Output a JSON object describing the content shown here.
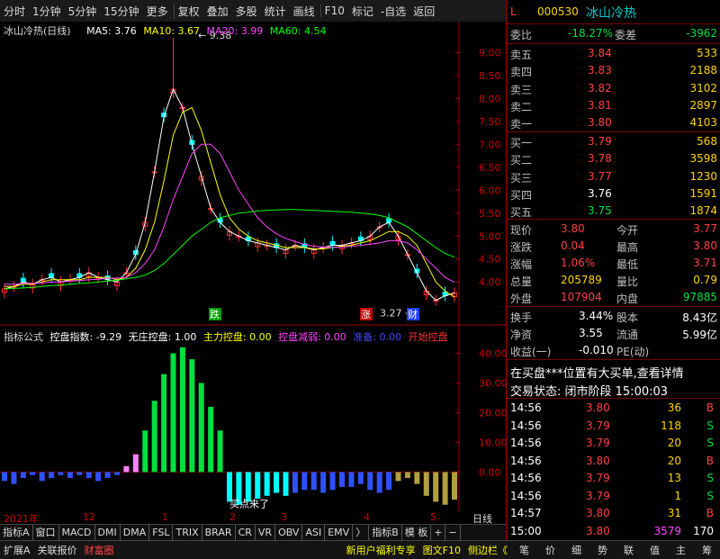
{
  "toolbar": [
    "分时",
    "1分钟",
    "5分钟",
    "15分钟",
    "更多",
    "复权",
    "叠加",
    "多股",
    "统计",
    "画线",
    "F10",
    "标记",
    "-自选",
    "返回"
  ],
  "main_info": {
    "title": "冰山冷热(日线)",
    "ma5_label": "MA5: 3.76",
    "ma10_label": "MA10: 3.67",
    "ma20_label": "MA20: 3.99",
    "ma60_label": "MA60: 4.54",
    "high_marker": "9.38",
    "low_marker": "3.27",
    "tag_down": "跌",
    "tag_up": "涨",
    "tag_cai": "财"
  },
  "indicator_info": {
    "name": "指标公式",
    "kp_label": "控盘指数: -9.29",
    "wz_label": "无庄控盘: 1.00",
    "zl_label": "主力控盘: 0.00",
    "kpjr_label": "控盘减弱: 0.00",
    "lj_label": "准备: 0.00",
    "ks_label": "开始控盘",
    "note_buy": "买点来了"
  },
  "colors": {
    "up": "#ff3030",
    "down": "#00ffff",
    "ma5": "#ffffff",
    "ma10": "#ffff00",
    "ma20": "#ff44ff",
    "ma60": "#00ff00",
    "axis": "#a00000"
  },
  "chart_data": [
    {
      "type": "line",
      "name": "k-line",
      "title": "冰山冷热(日线)",
      "y_ticks": [
        "9.00",
        "8.50",
        "8.00",
        "7.50",
        "7.00",
        "6.50",
        "6.00",
        "5.50",
        "5.00",
        "4.50",
        "4.00"
      ],
      "ylim": [
        3.2,
        9.4
      ],
      "series": [
        {
          "name": "MA5",
          "values": [
            3.85,
            3.9,
            4.0,
            3.95,
            4.05,
            4.1,
            4.0,
            4.05,
            4.1,
            4.2,
            4.1,
            4.05,
            4.0,
            4.2,
            4.6,
            5.3,
            6.4,
            7.6,
            8.2,
            7.8,
            7.0,
            6.3,
            5.6,
            5.3,
            5.1,
            5.0,
            4.9,
            4.85,
            4.8,
            4.75,
            4.7,
            4.8,
            4.75,
            4.7,
            4.75,
            4.8,
            4.8,
            4.85,
            4.9,
            5.0,
            5.2,
            5.3,
            5.0,
            4.6,
            4.2,
            3.8,
            3.6,
            3.7,
            3.76
          ]
        },
        {
          "name": "MA10",
          "values": [
            3.9,
            3.9,
            3.95,
            3.95,
            4.0,
            4.05,
            4.05,
            4.05,
            4.05,
            4.1,
            4.1,
            4.1,
            4.05,
            4.1,
            4.3,
            4.7,
            5.3,
            6.2,
            7.2,
            7.7,
            7.8,
            7.3,
            6.6,
            5.9,
            5.4,
            5.15,
            5.0,
            4.9,
            4.85,
            4.8,
            4.75,
            4.75,
            4.75,
            4.72,
            4.72,
            4.75,
            4.78,
            4.8,
            4.85,
            4.9,
            5.0,
            5.1,
            5.1,
            5.0,
            4.8,
            4.4,
            4.0,
            3.8,
            3.67
          ]
        },
        {
          "name": "MA20",
          "values": [
            3.95,
            3.95,
            3.97,
            3.97,
            3.98,
            4.0,
            4.0,
            4.02,
            4.03,
            4.05,
            4.06,
            4.08,
            4.08,
            4.1,
            4.2,
            4.4,
            4.7,
            5.2,
            5.8,
            6.3,
            6.8,
            7.0,
            7.0,
            6.8,
            6.4,
            6.0,
            5.7,
            5.4,
            5.2,
            5.05,
            4.95,
            4.88,
            4.82,
            4.78,
            4.76,
            4.75,
            4.76,
            4.78,
            4.8,
            4.82,
            4.85,
            4.9,
            4.9,
            4.85,
            4.7,
            4.5,
            4.3,
            4.1,
            3.99
          ]
        },
        {
          "name": "MA60",
          "values": [
            3.85,
            3.86,
            3.87,
            3.88,
            3.9,
            3.92,
            3.93,
            3.95,
            3.97,
            3.98,
            4.0,
            4.02,
            4.04,
            4.07,
            4.1,
            4.15,
            4.25,
            4.4,
            4.6,
            4.8,
            5.0,
            5.15,
            5.3,
            5.4,
            5.45,
            5.5,
            5.52,
            5.55,
            5.56,
            5.57,
            5.58,
            5.58,
            5.57,
            5.56,
            5.55,
            5.54,
            5.53,
            5.52,
            5.5,
            5.48,
            5.45,
            5.4,
            5.3,
            5.2,
            5.05,
            4.9,
            4.75,
            4.62,
            4.54
          ]
        }
      ]
    },
    {
      "type": "bar",
      "name": "indicator",
      "y_ticks": [
        "40.00",
        "30.00",
        "20.00",
        "10.00",
        "0.00"
      ],
      "ylim": [
        -12,
        45
      ],
      "values": [
        -3,
        -4,
        -2,
        -1,
        -3,
        -2,
        -1,
        -2,
        -1,
        -2,
        -3,
        -2,
        -1,
        2,
        6,
        14,
        24,
        33,
        40,
        42,
        38,
        30,
        22,
        14,
        -10,
        -11,
        -10,
        -9,
        -8,
        -7,
        -8,
        -7,
        -6,
        -6,
        -7,
        -6,
        -5,
        -5,
        -4,
        -6,
        -7,
        -6,
        -3,
        -2,
        -4,
        -8,
        -10,
        -11,
        -9.29
      ]
    }
  ],
  "x_labels": [
    "2021年",
    "12",
    "1",
    "2",
    "3",
    "4",
    "5"
  ],
  "period_label": "日线",
  "tabs": [
    "指标A",
    "窗口",
    "MACD",
    "DMI",
    "DMA",
    "FSL",
    "TRIX",
    "BRAR",
    "CR",
    "VR",
    "OBV",
    "ASI",
    "EMV",
    "〉",
    "指标B",
    "模 板",
    "+",
    "−"
  ],
  "bottom_left": [
    "扩展A",
    "关联报价",
    "财富圈"
  ],
  "bottom_mid": [
    "新用户福利专享",
    "图文F10",
    "侧边栏《"
  ],
  "bottom_right": [
    "笔",
    "价",
    "细",
    "势",
    "联",
    "值",
    "主",
    "筹"
  ],
  "quote": {
    "code": "000530",
    "name": "冰山冷热",
    "flag": "L",
    "weibi_label": "委比",
    "weibi": "-18.27%",
    "weicha_label": "委差",
    "weicha": "-3962",
    "asks": [
      {
        "l": "卖五",
        "p": "3.84",
        "v": "533"
      },
      {
        "l": "卖四",
        "p": "3.83",
        "v": "2188"
      },
      {
        "l": "卖三",
        "p": "3.82",
        "v": "3102"
      },
      {
        "l": "卖二",
        "p": "3.81",
        "v": "2897"
      },
      {
        "l": "卖一",
        "p": "3.80",
        "v": "4103"
      }
    ],
    "bids": [
      {
        "l": "买一",
        "p": "3.79",
        "v": "568"
      },
      {
        "l": "买二",
        "p": "3.78",
        "v": "3598"
      },
      {
        "l": "买三",
        "p": "3.77",
        "v": "1230"
      },
      {
        "l": "买四",
        "p": "3.76",
        "v": "1591"
      },
      {
        "l": "买五",
        "p": "3.75",
        "v": "1874"
      }
    ],
    "stats": [
      {
        "l1": "现价",
        "v1": "3.80",
        "l2": "今开",
        "v2": "3.77"
      },
      {
        "l1": "涨跌",
        "v1": "0.04",
        "l2": "最高",
        "v2": "3.80"
      },
      {
        "l1": "涨幅",
        "v1": "1.06%",
        "l2": "最低",
        "v2": "3.71"
      },
      {
        "l1": "总量",
        "v1": "205789",
        "l2": "量比",
        "v2": "0.79"
      },
      {
        "l1": "外盘",
        "v1": "107904",
        "l2": "内盘",
        "v2": "97885"
      }
    ],
    "stats2": [
      {
        "l1": "换手",
        "v1": "3.44%",
        "l2": "股本",
        "v2": "8.43亿"
      },
      {
        "l1": "净资",
        "v1": "3.55",
        "l2": "流通",
        "v2": "5.99亿"
      },
      {
        "l1": "收益(一)",
        "v1": "-0.010",
        "l2": "PE(动)",
        "v2": ""
      }
    ],
    "notice": "在买盘***位置有大买单,查看详情",
    "status": "交易状态: 闭市阶段 15:00:03",
    "ticks": [
      {
        "t": "14:56",
        "p": "3.80",
        "v": "36",
        "d": "B"
      },
      {
        "t": "14:56",
        "p": "3.79",
        "v": "118",
        "d": "S"
      },
      {
        "t": "14:56",
        "p": "3.79",
        "v": "20",
        "d": "S"
      },
      {
        "t": "14:56",
        "p": "3.80",
        "v": "20",
        "d": "B"
      },
      {
        "t": "14:56",
        "p": "3.79",
        "v": "13",
        "d": "S"
      },
      {
        "t": "14:56",
        "p": "3.79",
        "v": "1",
        "d": "S"
      },
      {
        "t": "14:57",
        "p": "3.80",
        "v": "31",
        "d": "B"
      },
      {
        "t": "15:00",
        "p": "3.80",
        "v": "3579",
        "d": "170"
      }
    ]
  }
}
